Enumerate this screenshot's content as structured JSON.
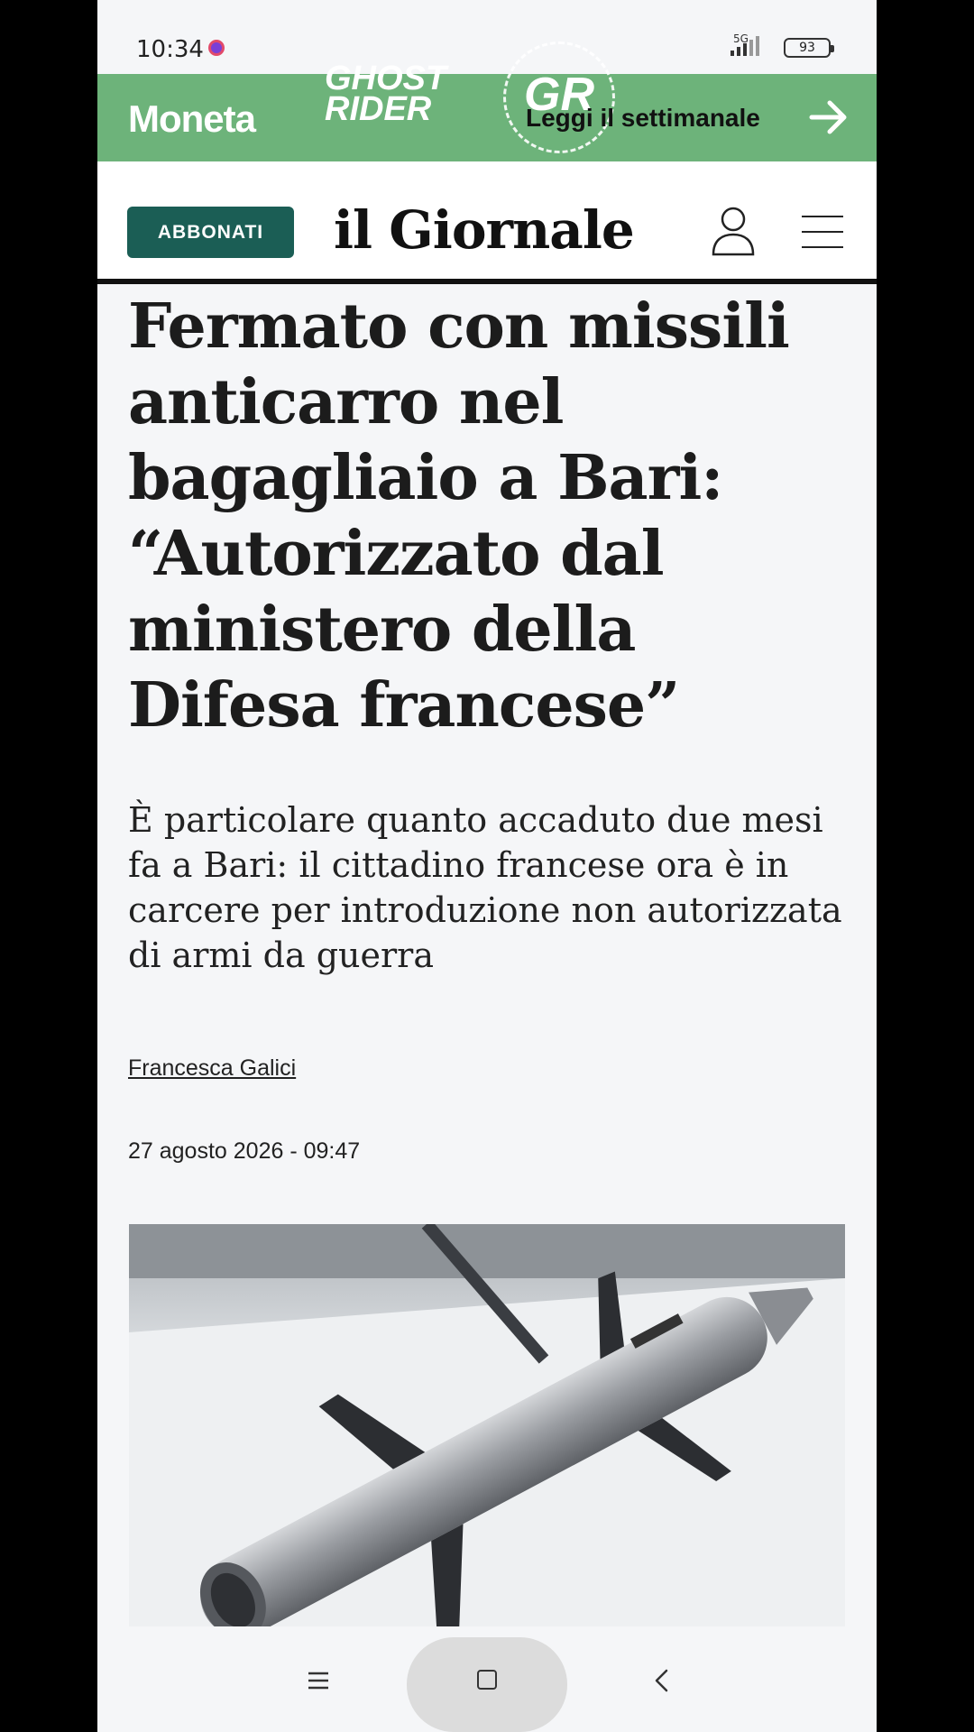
{
  "status_bar": {
    "time": "10:34",
    "network": "5G",
    "battery": "93"
  },
  "promo_banner": {
    "brand": "Moneta",
    "logo_text_1": "GHOST",
    "logo_text_2": "RIDER",
    "logo_badge": "GR",
    "cta": "Leggi il settimanale",
    "background_color": "#6db37a"
  },
  "masthead": {
    "subscribe_label": "ABBONATI",
    "logo": "il Giornale",
    "accent_color": "#1b5e55"
  },
  "article": {
    "headline": "Fermato con missili anticarro nel bagagliaio a Bari: “Autorizzato dal ministero della Difesa francese”",
    "subheadline": "È particolare quanto accaduto due mesi fa a Bari: il cittadino francese ora è in carcere per introduzione non autorizzata di armi da guerra",
    "author": "Francesca Galici",
    "date": "27 agosto 2026 - 09:47"
  },
  "icons": {
    "user": "user-icon",
    "menu": "hamburger-menu-icon",
    "arrow": "arrow-right-icon"
  }
}
